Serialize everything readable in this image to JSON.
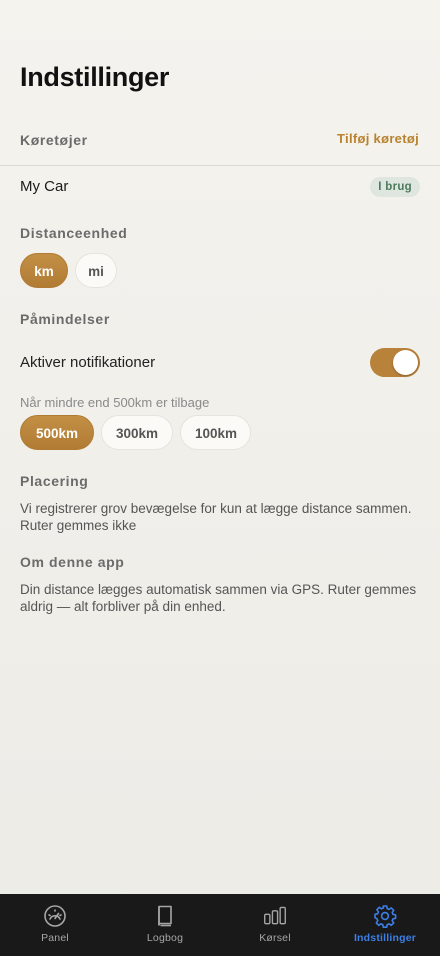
{
  "header": {
    "title": "Indstillinger"
  },
  "vehicles": {
    "section_title": "Køretøjer",
    "add_label": "Tilføj køretøj",
    "items": [
      {
        "name": "My Car",
        "badge": "I brug"
      }
    ]
  },
  "distance_unit": {
    "section_title": "Distanceenhed",
    "options": [
      {
        "label": "km",
        "selected": true
      },
      {
        "label": "mi",
        "selected": false
      }
    ]
  },
  "reminders": {
    "section_title": "Påmindelser",
    "toggle_label": "Aktiver notifikationer",
    "toggle_on": true,
    "threshold_label": "Når mindre end 500km er tilbage",
    "options": [
      {
        "label": "500km",
        "selected": true
      },
      {
        "label": "300km",
        "selected": false
      },
      {
        "label": "100km",
        "selected": false
      }
    ]
  },
  "location": {
    "section_title": "Placering",
    "text": "Vi registrerer grov bevægelse for kun at lægge distance sammen. Ruter gemmes ikke"
  },
  "about": {
    "section_title": "Om denne app",
    "text": "Din distance lægges automatisk sammen via GPS. Ruter gemmes aldrig — alt forbliver på din enhed."
  },
  "tabbar": {
    "active_color": "#3c7fe8",
    "accent_color": "#b9822f",
    "items": [
      {
        "label": "Panel",
        "icon": "gauge-icon",
        "active": false
      },
      {
        "label": "Logbog",
        "icon": "book-icon",
        "active": false
      },
      {
        "label": "Kørsel",
        "icon": "bar-chart-icon",
        "active": false
      },
      {
        "label": "Indstillinger",
        "icon": "gear-icon",
        "active": true
      }
    ]
  }
}
